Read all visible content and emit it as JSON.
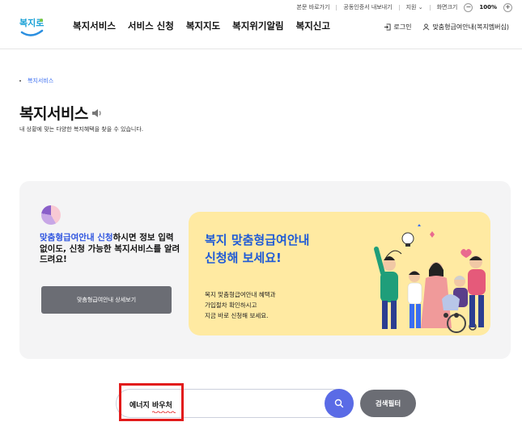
{
  "utility": {
    "shortcut": "본문 바로가기",
    "cert": "공동인증서 내보내기",
    "language": "지원",
    "zoom_label": "화면크기",
    "zoom_minus": "−",
    "zoom_value": "100%",
    "zoom_plus": "+"
  },
  "logo": {
    "text": "복지로"
  },
  "nav": {
    "items": [
      "복지서비스",
      "서비스 신청",
      "복지지도",
      "복지위기알림",
      "복지신고"
    ]
  },
  "header_right": {
    "login": "로그인",
    "membership": "맞춤형급여안내(복지멤버십)"
  },
  "breadcrumb": {
    "current": "복지서비스"
  },
  "page": {
    "title": "복지서비스",
    "description": "내 상황에 맞는 다양한 복지혜택을 찾을 수 있습니다."
  },
  "banner": {
    "headline_highlight": "맞춤형급여안내 신청",
    "headline_rest": "하시면 정보 입력 없이도, 신청 가능한 복지서비스를 알려드려요!",
    "detail_button": "맞춤형급여안내 상세보기",
    "card_title_line1": "복지 맞춤형급여안내",
    "card_title_line2": "신청해 보세요!",
    "card_sub_line1": "복지 맞춤형급여안내 혜택과",
    "card_sub_line2": "가입절차 확인하시고",
    "card_sub_line3": "지금 바로 신청해 보세요."
  },
  "search": {
    "value": "에너지 바우처",
    "filter_button": "검색필터"
  },
  "colors": {
    "accent_blue": "#2f55e0",
    "search_button": "#5a6be6",
    "highlight_red": "#e21b1b",
    "card_yellow": "#ffeaa2"
  }
}
